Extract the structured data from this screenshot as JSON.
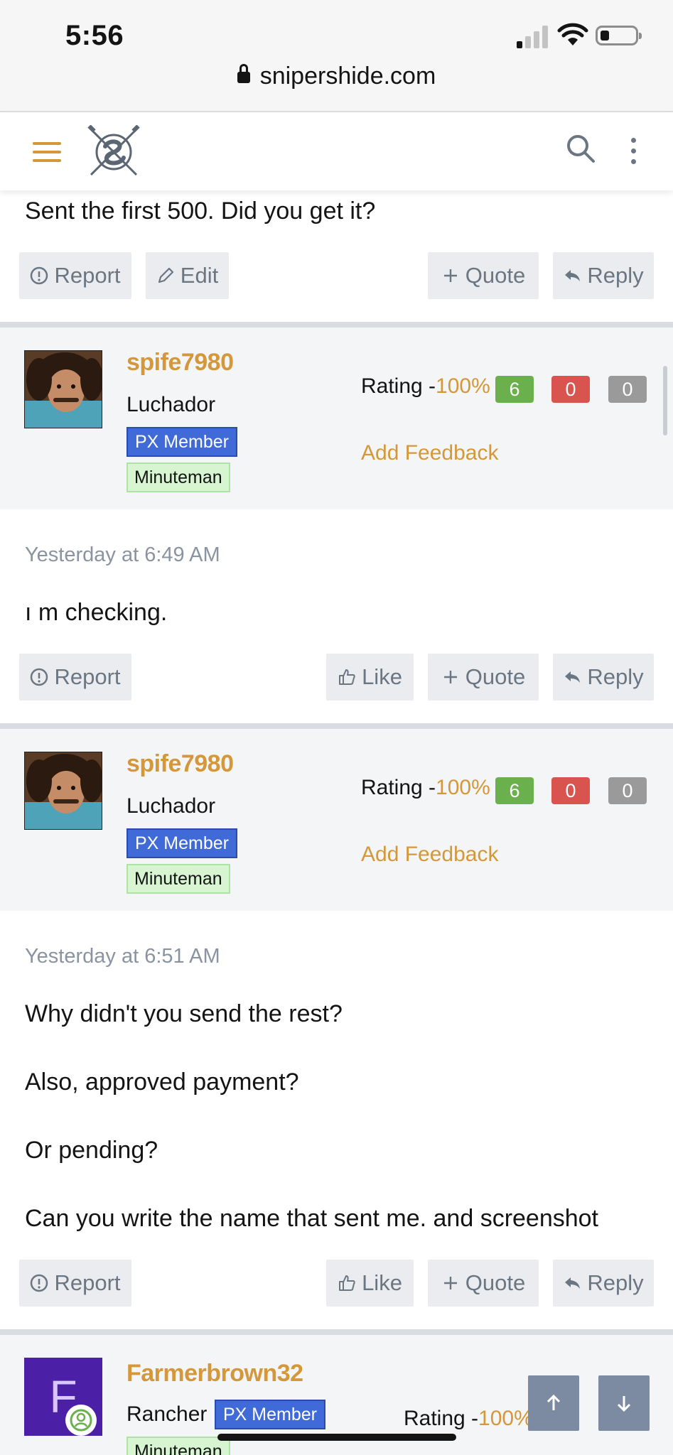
{
  "status_bar": {
    "time": "5:56",
    "url": "snipershide.com"
  },
  "header": {
    "menu_icon": "hamburger-icon",
    "logo": "snipershide-logo",
    "search_icon": "search-icon",
    "more_icon": "more-vertical-icon"
  },
  "colors": {
    "accent": "#d4973a",
    "button_bg": "#eaecef",
    "button_text": "#6b7683",
    "px_badge": "#3f6ad8",
    "minuteman_badge": "#d6f5d0",
    "pill_green": "#6ab04c",
    "pill_red": "#d9534f",
    "pill_gray": "#9a9a9a"
  },
  "post1": {
    "text": "Sent the first 500. Did you get it?",
    "actions": {
      "report": "Report",
      "edit": "Edit",
      "quote": "Quote",
      "reply": "Reply"
    }
  },
  "post2": {
    "user": {
      "name": "spife7980",
      "title": "Luchador",
      "badge_px": "PX Member",
      "badge_rank": "Minuteman",
      "rating_label": "Rating -",
      "rating_pct": "100%",
      "pos": "6",
      "neg": "0",
      "neu": "0",
      "feedback": "Add Feedback"
    },
    "date": "Yesterday at 6:49 AM",
    "text": "ı m checking.",
    "actions": {
      "report": "Report",
      "like": "Like",
      "quote": "Quote",
      "reply": "Reply"
    }
  },
  "post3": {
    "user": {
      "name": "spife7980",
      "title": "Luchador",
      "badge_px": "PX Member",
      "badge_rank": "Minuteman",
      "rating_label": "Rating -",
      "rating_pct": "100%",
      "pos": "6",
      "neg": "0",
      "neu": "0",
      "feedback": "Add Feedback"
    },
    "date": "Yesterday at 6:51 AM",
    "lines": [
      "Why didn't you send the rest?",
      "Also, approved payment?",
      "Or pending?",
      "Can you write the name that sent me. and screenshot"
    ],
    "actions": {
      "report": "Report",
      "like": "Like",
      "quote": "Quote",
      "reply": "Reply"
    }
  },
  "post4": {
    "user": {
      "avatar_letter": "F",
      "name": "Farmerbrown32",
      "title": "Rancher",
      "badge_px": "PX Member",
      "badge_rank": "Minuteman",
      "rating_label": "Rating -",
      "rating_pct": "100%"
    }
  },
  "floating": {
    "up_icon": "arrow-up-icon",
    "down_icon": "arrow-down-icon"
  }
}
